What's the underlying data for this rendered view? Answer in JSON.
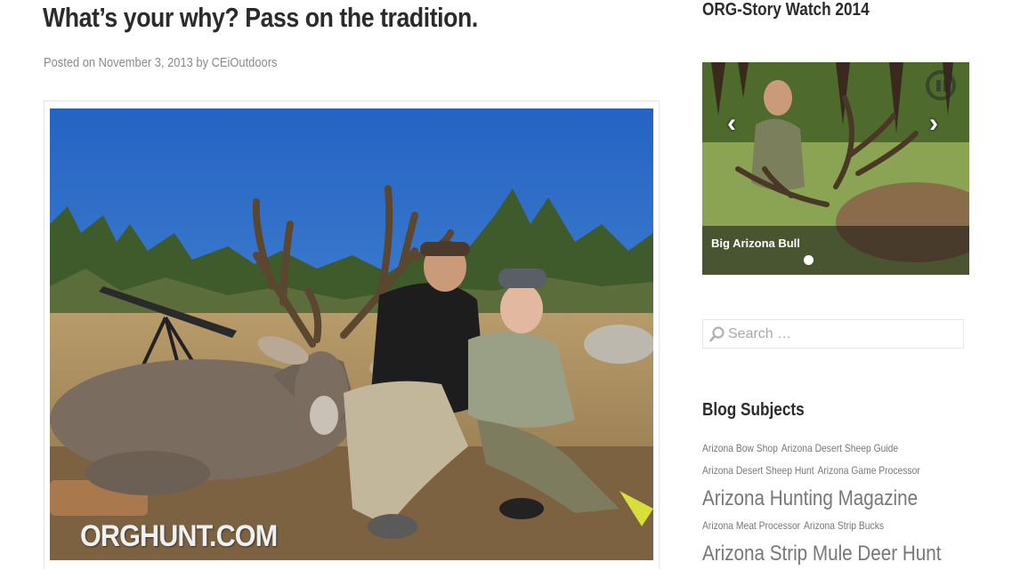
{
  "post": {
    "title": "What’s your why? Pass on the tradition.",
    "meta_prefix": "Posted on ",
    "date": "November 3, 2013",
    "meta_by": " by ",
    "author": "CEiOutdoors",
    "image_watermark": "ORGHUNT.COM"
  },
  "sidebar": {
    "story_widget_title": "ORG-Story Watch 2014",
    "slider": {
      "caption": "Big Arizona Bull",
      "prev_icon": "chevron-left-icon",
      "next_icon": "chevron-right-icon",
      "pause_icon": "pause-icon"
    },
    "search": {
      "placeholder": "Search …"
    },
    "subjects_title": "Blog Subjects",
    "tags": [
      {
        "label": "Arizona Bow Shop",
        "size": "small"
      },
      {
        "label": "Arizona Desert Sheep Guide",
        "size": "small"
      },
      {
        "label": "Arizona Desert Sheep Hunt",
        "size": "small"
      },
      {
        "label": "Arizona Game Processor",
        "size": "small"
      },
      {
        "label": "Arizona Hunting Magazine",
        "size": "large"
      },
      {
        "label": "Arizona Meat Processor",
        "size": "small"
      },
      {
        "label": "Arizona Strip Bucks",
        "size": "small"
      },
      {
        "label": "Arizona Strip Mule Deer Hunt",
        "size": "large"
      }
    ]
  },
  "colors": {
    "text_dark": "#2b2b2b",
    "meta_gray": "#8a8a8a",
    "tag_gray": "#777777",
    "sky_blue": "#2f73c8"
  }
}
